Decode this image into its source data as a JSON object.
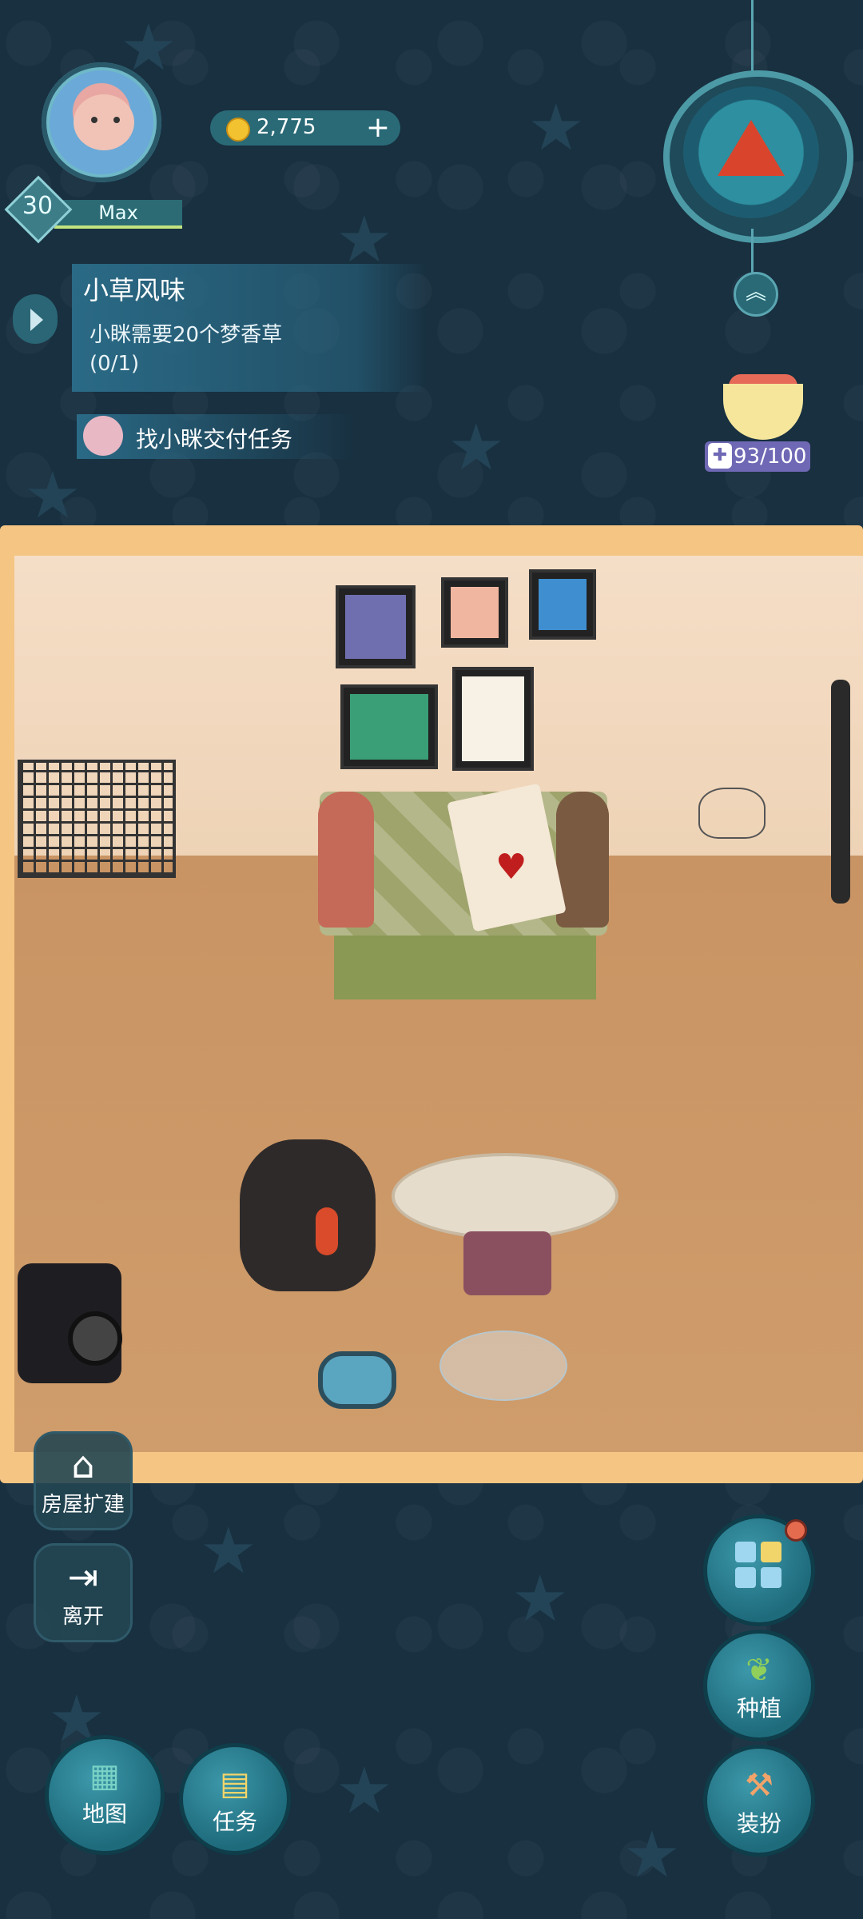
{
  "player": {
    "level": "30",
    "name": "Max",
    "coins": "2,775",
    "plus_symbol": "+"
  },
  "quest": {
    "title": "小草风味",
    "description": "小眯需要20个梦香草",
    "progress": "(0/1)",
    "deliver_label": "找小眯交付任务"
  },
  "energy": {
    "value": "93/100"
  },
  "left_buttons": {
    "expand": "房屋扩建",
    "leave": "离开"
  },
  "right_buttons": {
    "plant": "种植",
    "dress": "装扮"
  },
  "bottom_buttons": {
    "map": "地图",
    "tasks": "任务"
  },
  "colors": {
    "background": "#183040",
    "room_frame": "#f5c583",
    "accent_teal": "#2a6a76",
    "energy_purple": "#6f68b5"
  }
}
